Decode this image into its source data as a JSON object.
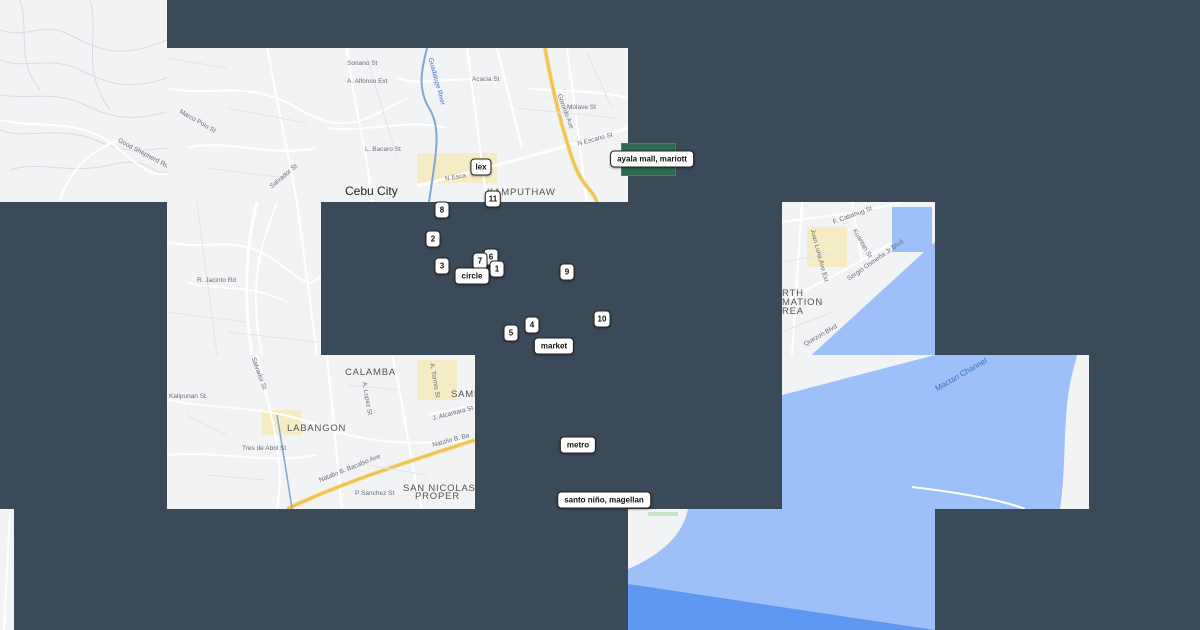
{
  "map": {
    "colors": {
      "background": "#3a4a59",
      "land": "#f2f3f5",
      "water": "#9ec0f8",
      "water_deep": "#5f98f2",
      "highway": "#f6cf65",
      "road": "#ffffff",
      "river": "#7fa8d6",
      "urban": "#f5ebc4"
    },
    "labels": {
      "city": "Cebu City",
      "districts": {
        "kamputhaw": "KAMPUTHAW",
        "calamba": "CALAMBA",
        "labangon": "LABANGON",
        "sambag": "SAMB",
        "san_nicolas_1": "SAN NICOLAS",
        "san_nicolas_2": "PROPER",
        "north_reclamation_1": "RTH",
        "north_reclamation_2": "MATION",
        "north_reclamation_3": "REA"
      },
      "streets": {
        "n_escario": "N Escario St",
        "n_escario_2": "N Esca",
        "gorordo": "Gorordo Ave",
        "salvador": "Salvador St",
        "salvador_2": "Salvador St",
        "natalio": "Natalio B. Bacalso Ave",
        "natalio_2": "Natalio B. Ba",
        "kalipunan": "Kalipunan St",
        "tres_de_abril": "Tres de Abril St",
        "sergio": "Sergio Osmeña Jr Blvd",
        "juan_luna": "Juan Luna Ave Ext",
        "f_cabahug": "F. Cabahug St",
        "l_bacaro": "L. Bacaro St",
        "a_tormis": "A. Tormis St",
        "j_alcantara": "J. Alcantara St",
        "good_shepherd": "Good Shepherd Rd",
        "marco_polo": "Marco Polo St",
        "a_lopez": "A. Lopez St",
        "p_sancas": "P Sanchez St",
        "quezon": "Quezon Blvd",
        "mactan_channel": "Mactan Channel",
        "kuantan": "Kuantan St",
        "guadalupe": "Guadalupe River",
        "r_jacinto": "R. Jacinto Rd",
        "acacia": "Acacia St",
        "bo_st": "Bo. St",
        "alfonso": "A. Alfonso Ext",
        "soriano": "Soriano St",
        "molave": "Molave St"
      }
    }
  },
  "markers": [
    {
      "id": "lex",
      "label": "lex"
    },
    {
      "id": "ayala",
      "label": "ayala mall, mariott"
    },
    {
      "id": "m11",
      "label": "11"
    },
    {
      "id": "m8",
      "label": "8"
    },
    {
      "id": "m2",
      "label": "2"
    },
    {
      "id": "m3",
      "label": "3"
    },
    {
      "id": "m7",
      "label": "7"
    },
    {
      "id": "m6",
      "label": "6"
    },
    {
      "id": "m1",
      "label": "1"
    },
    {
      "id": "circle",
      "label": "circle"
    },
    {
      "id": "m9",
      "label": "9"
    },
    {
      "id": "m10",
      "label": "10"
    },
    {
      "id": "m5",
      "label": "5"
    },
    {
      "id": "m4",
      "label": "4"
    },
    {
      "id": "market",
      "label": "market"
    },
    {
      "id": "metro",
      "label": "metro"
    },
    {
      "id": "santo_nino",
      "label": "santo niño, magellan"
    }
  ]
}
